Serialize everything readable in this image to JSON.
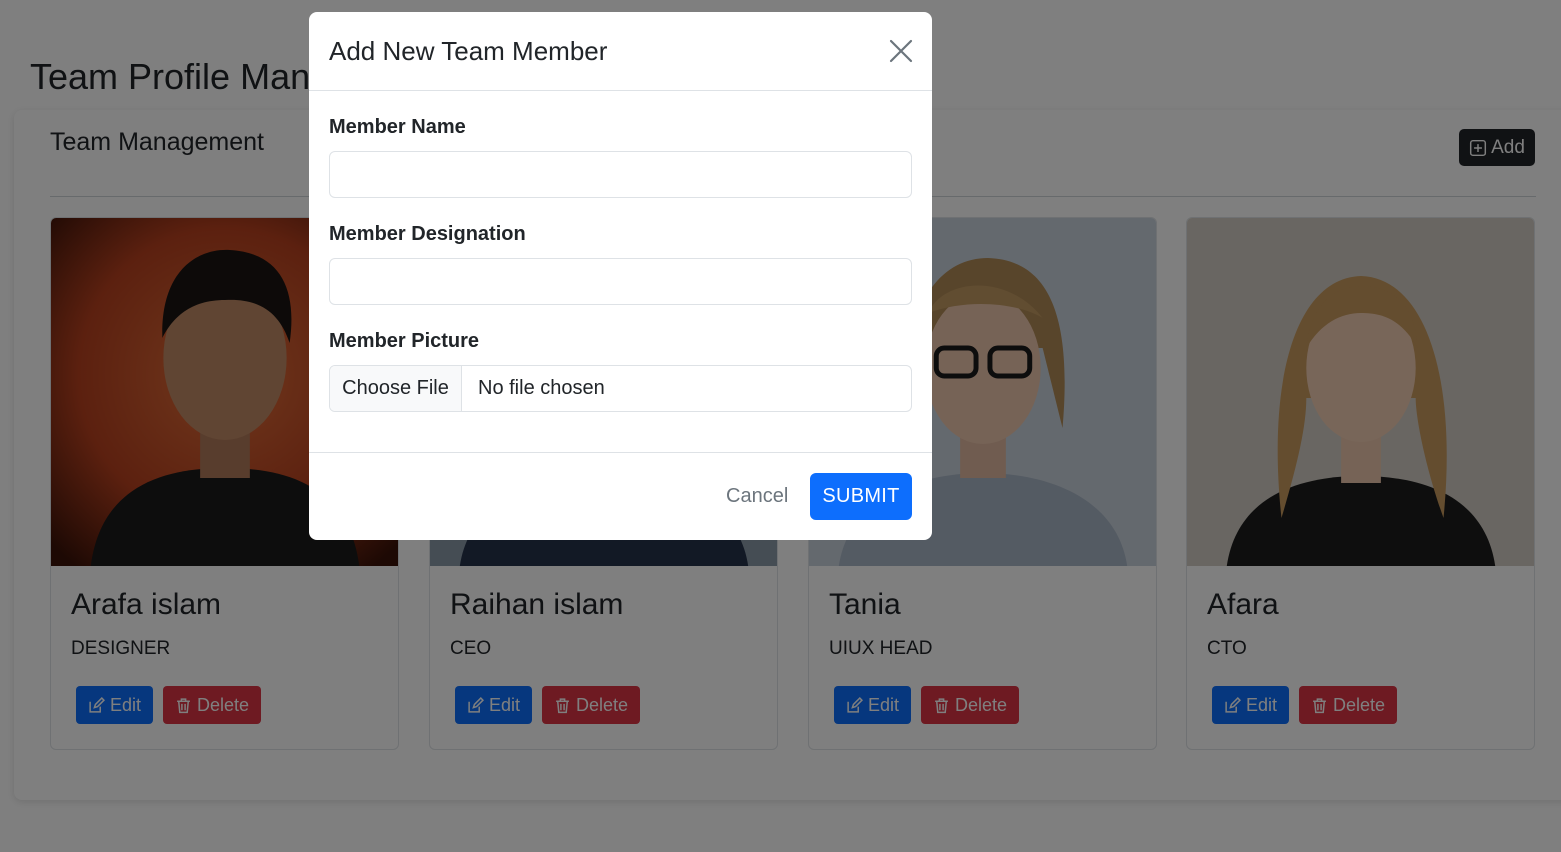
{
  "page": {
    "title": "Team Profile Management"
  },
  "panel": {
    "title": "Team Management",
    "add_label": "Add"
  },
  "members": [
    {
      "name": "Arafa islam",
      "designation": "DESIGNER",
      "edit_label": "Edit",
      "delete_label": "Delete"
    },
    {
      "name": "Raihan islam",
      "designation": "CEO",
      "edit_label": "Edit",
      "delete_label": "Delete"
    },
    {
      "name": "Tania",
      "designation": "UIUX HEAD",
      "edit_label": "Edit",
      "delete_label": "Delete"
    },
    {
      "name": "Afara",
      "designation": "CTO",
      "edit_label": "Edit",
      "delete_label": "Delete"
    }
  ],
  "modal": {
    "title": "Add New Team Member",
    "name_label": "Member Name",
    "name_value": "",
    "designation_label": "Member Designation",
    "designation_value": "",
    "picture_label": "Member Picture",
    "choose_file_label": "Choose File",
    "file_status": "No file chosen",
    "cancel_label": "Cancel",
    "submit_label": "SUBMIT"
  },
  "icons": {
    "close": "close-icon",
    "add": "plus-square-icon",
    "edit": "pencil-square-icon",
    "delete": "trash-icon"
  },
  "colors": {
    "primary": "#0d6efd",
    "danger": "#dc3545",
    "dark": "#212529",
    "backdrop": "rgba(0,0,0,0.5)"
  }
}
